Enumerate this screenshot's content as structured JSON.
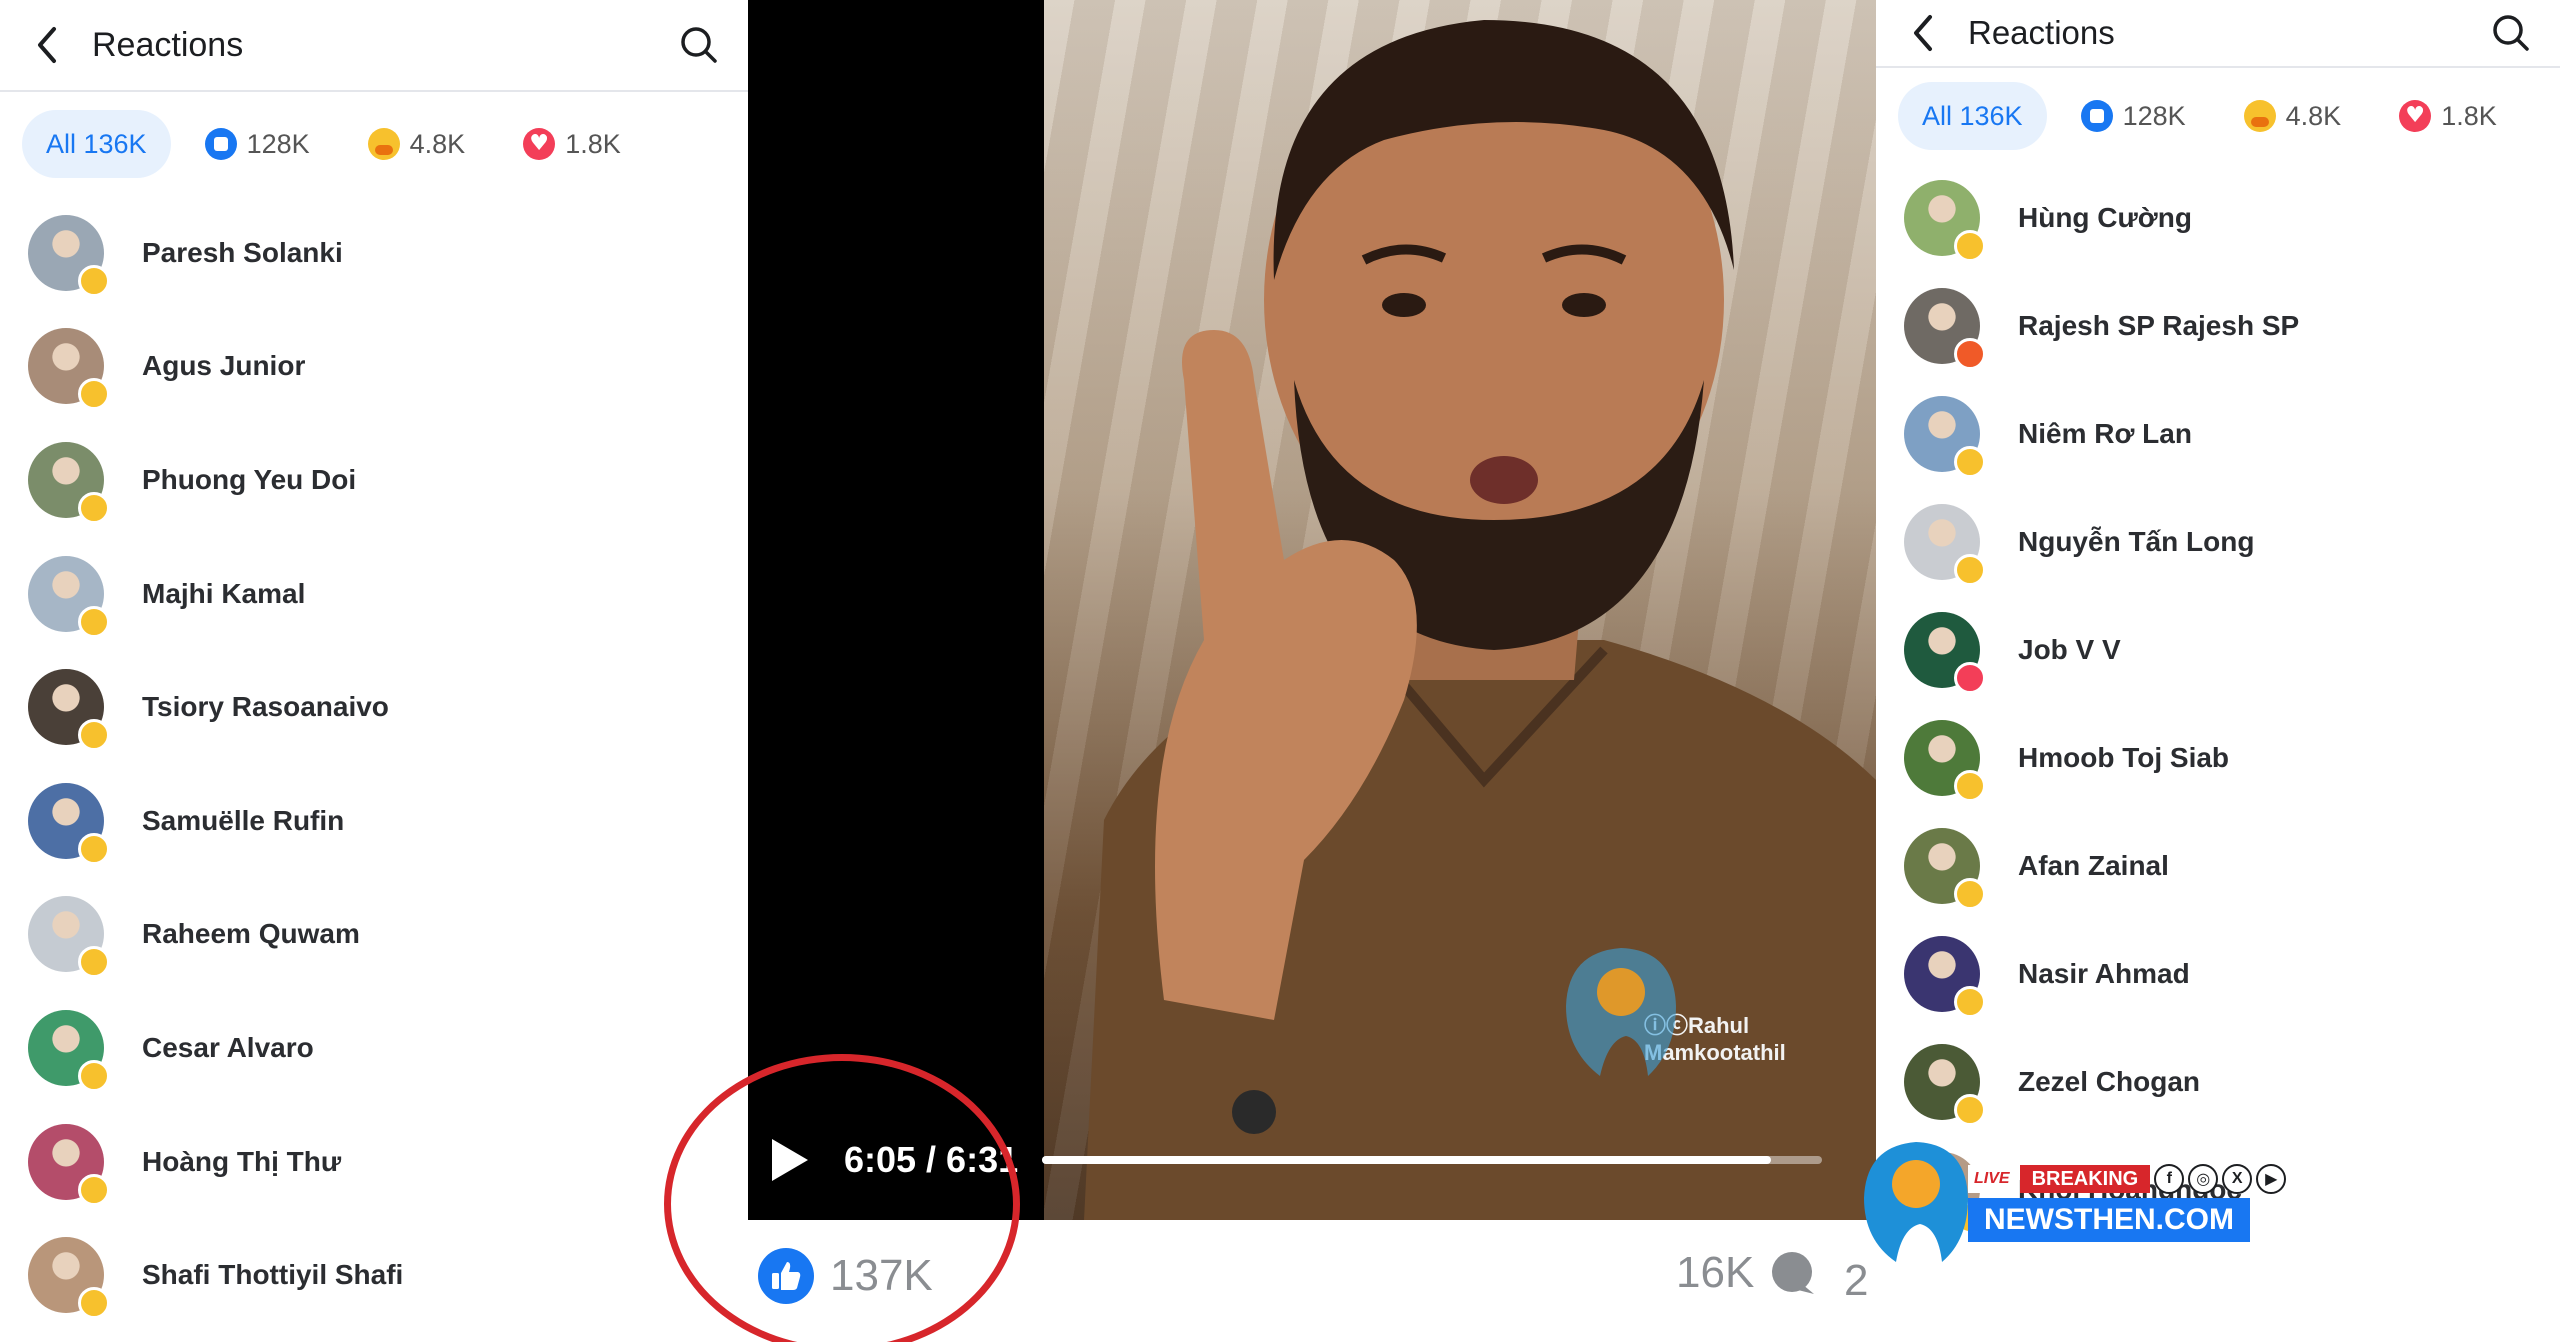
{
  "left_panel": {
    "title": "Reactions",
    "tabs": [
      {
        "label": "All 136K",
        "reaction": "all"
      },
      {
        "label": "128K",
        "reaction": "like"
      },
      {
        "label": "4.8K",
        "reaction": "care"
      },
      {
        "label": "1.8K",
        "reaction": "love"
      }
    ],
    "people": [
      {
        "name": "Paresh Solanki",
        "reaction": "care",
        "avatar_color": "#9aa7b4"
      },
      {
        "name": "Agus Junior",
        "reaction": "care",
        "avatar_color": "#a88c78"
      },
      {
        "name": "Phuong Yeu Doi",
        "reaction": "care",
        "avatar_color": "#7b8d6a"
      },
      {
        "name": "Majhi Kamal",
        "reaction": "care",
        "avatar_color": "#a6b6c6"
      },
      {
        "name": "Tsiory Rasoanaivo",
        "reaction": "care",
        "avatar_color": "#4a4038"
      },
      {
        "name": "Samuëlle Rufin",
        "reaction": "care",
        "avatar_color": "#4d6fa5"
      },
      {
        "name": "Raheem Quwam",
        "reaction": "care",
        "avatar_color": "#c5cbd2"
      },
      {
        "name": "Cesar Alvaro",
        "reaction": "care",
        "avatar_color": "#3f9a6a"
      },
      {
        "name": "Hoàng Thị Thư",
        "reaction": "care",
        "avatar_color": "#b44d6a"
      },
      {
        "name": "Shafi Thottiyil Shafi",
        "reaction": "care",
        "avatar_color": "#b9967a"
      }
    ]
  },
  "right_panel": {
    "title": "Reactions",
    "tabs": [
      {
        "label": "All 136K",
        "reaction": "all"
      },
      {
        "label": "128K",
        "reaction": "like"
      },
      {
        "label": "4.8K",
        "reaction": "care"
      },
      {
        "label": "1.8K",
        "reaction": "love"
      }
    ],
    "people": [
      {
        "name": "Hùng Cường",
        "reaction": "care",
        "avatar_color": "#8fb06c"
      },
      {
        "name": "Rajesh SP Rajesh SP",
        "reaction": "angry",
        "avatar_color": "#6f6a64"
      },
      {
        "name": "Niêm Rơ Lan",
        "reaction": "care",
        "avatar_color": "#7ea0c4"
      },
      {
        "name": "Nguyễn Tấn Long",
        "reaction": "care",
        "avatar_color": "#c9ccd1"
      },
      {
        "name": "Job V V",
        "reaction": "love",
        "avatar_color": "#1f5a3e"
      },
      {
        "name": "Hmoob Toj Siab",
        "reaction": "care",
        "avatar_color": "#4e7a3a"
      },
      {
        "name": "Afan Zainal",
        "reaction": "care",
        "avatar_color": "#6a7a48"
      },
      {
        "name": "Nasir Ahmad",
        "reaction": "care",
        "avatar_color": "#3a3570"
      },
      {
        "name": "Zezel Chogan",
        "reaction": "care",
        "avatar_color": "#4b5a36"
      },
      {
        "name": "Khoi Hoangngoc",
        "reaction": "care",
        "avatar_color": "#b59b86"
      }
    ]
  },
  "video": {
    "time": "6:05 / 6:31",
    "progress": 0.935,
    "watermark": "ⓘⓒRahul Mamkootathil",
    "likes": "137K",
    "comments": "16K",
    "shares": "2"
  },
  "brand": {
    "live": "LIVE",
    "breaking": "BREAKING",
    "site": "NEWSTHEN.COM",
    "socials": [
      "f",
      "◎",
      "X",
      "▶"
    ],
    "accent": "#1877f2",
    "red": "#d7262b"
  }
}
